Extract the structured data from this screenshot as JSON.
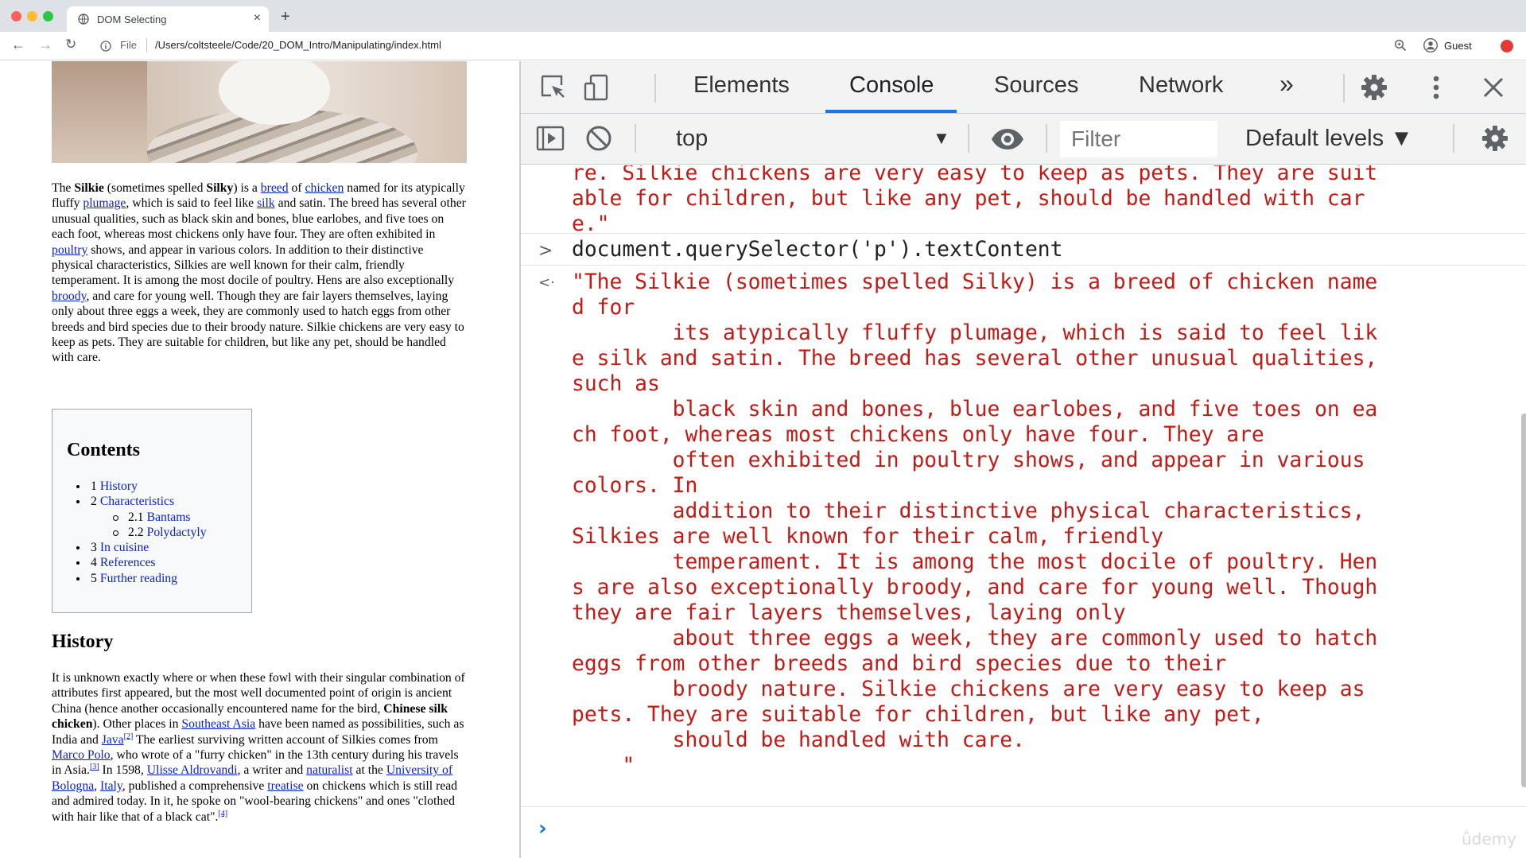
{
  "browser": {
    "tab_title": "DOM Selecting",
    "new_tab": "+",
    "tab_close": "×",
    "address_scheme": "File",
    "address_path": "/Users/coltsteele/Code/20_DOM_Intro/Manipulating/index.html",
    "profile_label": "Guest"
  },
  "page": {
    "toc": {
      "title": "Contents",
      "items": [
        {
          "num": "1",
          "label": "History"
        },
        {
          "num": "2",
          "label": "Characteristics"
        },
        {
          "num": "2.1",
          "label": "Bantams"
        },
        {
          "num": "2.2",
          "label": "Polydactyly"
        },
        {
          "num": "3",
          "label": "In cuisine"
        },
        {
          "num": "4",
          "label": "References"
        },
        {
          "num": "5",
          "label": "Further reading"
        }
      ]
    },
    "history_heading": "History",
    "para1": {
      "t1": "The ",
      "silkie": "Silkie",
      "t2": " (sometimes spelled ",
      "silky": "Silky",
      "t3": ") is a ",
      "breed": "breed",
      "t4": " of ",
      "chicken": "chicken",
      "t5": " named for its atypically fluffy ",
      "plumage": "plumage",
      "t6": ", which is said to feel like ",
      "silk": "silk",
      "t7": " and satin. The breed has several other unusual qualities, such as black skin and bones, blue earlobes, and five toes on each foot, whereas most chickens only have four. They are often exhibited in ",
      "poultry": "poultry",
      "t8": " shows, and appear in various colors. In addition to their distinctive physical characteristics, Silkies are well known for their calm, friendly temperament. It is among the most docile of poultry. Hens are also exceptionally ",
      "broody": "broody",
      "t9": ", and care for young well. Though they are fair layers themselves, laying only about three eggs a week, they are commonly used to hatch eggs from other breeds and bird species due to their broody nature. Silkie chickens are very easy to keep as pets. They are suitable for children, but like any pet, should be handled with care."
    },
    "para2": {
      "t1": "It is unknown exactly where or when these fowl with their singular combination of attributes first appeared, but the most well documented point of origin is ancient China (hence another occasionally encountered name for the bird, ",
      "csc": "Chinese silk chicken",
      "t2": "). Other places in ",
      "sea": "Southeast Asia",
      "t3": " have been named as possibilities, such as India and ",
      "java": "Java",
      "ref2": "[2]",
      "t4": " The earliest surviving written account of Silkies comes from ",
      "polo": "Marco Polo",
      "t5": ", who wrote of a \"furry chicken\" in the 13th century during his travels in Asia.",
      "ref3": "[3]",
      "t6": " In 1598, ",
      "ulisse": "Ulisse Aldrovandi",
      "t7": ", a writer and ",
      "naturalist": "naturalist",
      "t8": " at the ",
      "bologna": "University of Bologna",
      "t9": ", ",
      "italy": "Italy",
      "t10": ", published a comprehensive ",
      "treatise": "treatise",
      "t11": " on chickens which is still read and admired today. In it, he spoke on \"wool-bearing chickens\" and ones \"clothed with hair like that of a black cat\".",
      "ref4": "[4]"
    }
  },
  "devtools": {
    "tabs": [
      "Elements",
      "Console",
      "Sources",
      "Network"
    ],
    "more": "»",
    "context": "top",
    "filter_placeholder": "Filter",
    "levels": "Default levels ▼",
    "console": {
      "prev_result_lines": [
        "re. Silkie chickens are very easy to keep as pets. They are suit",
        "able for children, but like any pet, should be handled with car",
        "e.\""
      ],
      "input_glyph": ">",
      "input": "document.querySelector('p').textContent",
      "output_glyph": "<·",
      "output_lines": [
        "\"The Silkie (sometimes spelled Silky) is a breed of chicken name",
        "d for",
        "        its atypically fluffy plumage, which is said to feel lik",
        "e silk and satin. The breed has several other unusual qualities,",
        "such as",
        "        black skin and bones, blue earlobes, and five toes on ea",
        "ch foot, whereas most chickens only have four. They are",
        "        often exhibited in poultry shows, and appear in various",
        "colors. In",
        "        addition to their distinctive physical characteristics,",
        "Silkies are well known for their calm, friendly",
        "        temperament. It is among the most docile of poultry. Hen",
        "s are also exceptionally broody, and care for young well. Though",
        "they are fair layers themselves, laying only",
        "        about three eggs a week, they are commonly used to hatch",
        "eggs from other breeds and bird species due to their",
        "        broody nature. Silkie chickens are very easy to keep as",
        "pets. They are suitable for children, but like any pet,",
        "        should be handled with care.",
        "    \""
      ],
      "prompt_glyph": "›"
    }
  },
  "watermark": "ûdemy",
  "colors": {
    "console_string": "#c41a16",
    "link": "#0b22c4",
    "active_tab_underline": "#1a73e8"
  }
}
